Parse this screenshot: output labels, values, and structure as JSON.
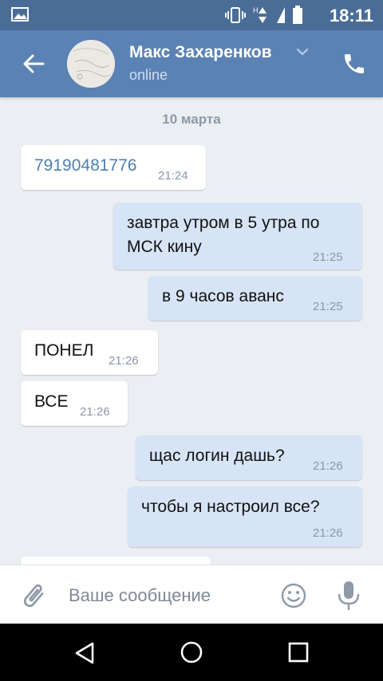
{
  "status_bar": {
    "time": "18:11",
    "icons": [
      "image-icon",
      "vibrate-icon",
      "network-h-icon",
      "signal-icon",
      "battery-icon"
    ],
    "network_label": "H"
  },
  "header": {
    "contact_name": "Макс Захаренков",
    "status": "online",
    "icons": [
      "back-arrow-icon",
      "chevron-down-icon",
      "phone-icon"
    ]
  },
  "chat": {
    "date_separator": "10 марта",
    "messages": [
      {
        "direction": "in",
        "text": "79190481776",
        "time": "21:24",
        "is_link": true
      },
      {
        "direction": "out",
        "text_lines": [
          "завтра утром в 5 утра по",
          "МСК кину"
        ],
        "time": "21:25"
      },
      {
        "direction": "out",
        "text": "в 9 часов аванс",
        "time": "21:25"
      },
      {
        "direction": "in",
        "text": "ПОНЕЛ",
        "time": "21:26"
      },
      {
        "direction": "in",
        "text": "ВСЕ",
        "time": "21:26"
      },
      {
        "direction": "out",
        "text": "щас логин дашь?",
        "time": "21:26"
      },
      {
        "direction": "out",
        "text": "чтобы я настроил все?",
        "time": "21:26"
      }
    ]
  },
  "input": {
    "placeholder": "Ваше сообщение",
    "value": "",
    "icons": [
      "paperclip-icon",
      "emoji-icon",
      "microphone-icon"
    ]
  },
  "nav_bar": {
    "icons": [
      "nav-back-icon",
      "nav-home-icon",
      "nav-recents-icon"
    ]
  },
  "colors": {
    "status_bar": "#4a6d98",
    "header": "#5b82b4",
    "chat_background": "#ebeff3",
    "incoming_bubble": "#ffffff",
    "outgoing_bubble": "#d6e4f5",
    "link": "#4f7fb3"
  }
}
